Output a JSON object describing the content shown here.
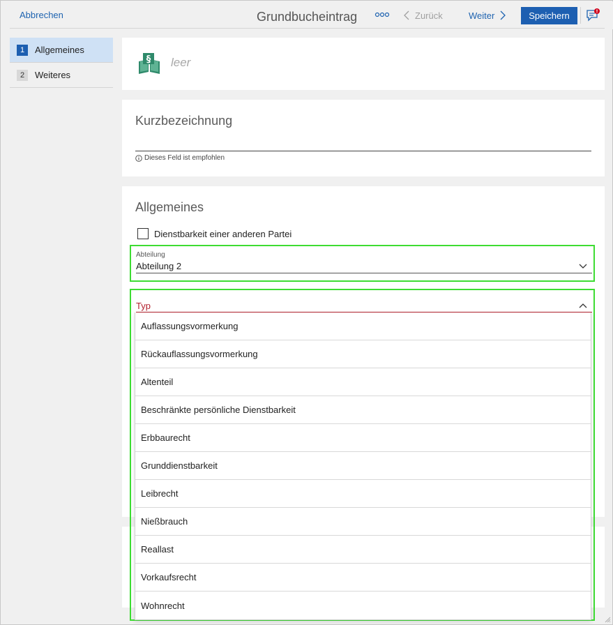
{
  "header": {
    "cancel_label": "Abbrechen",
    "title": "Grundbucheintrag",
    "more_icon": "more-horizontal-icon",
    "back_label": "Zurück",
    "forward_label": "Weiter",
    "save_label": "Speichern",
    "chat_icon": "chat-notification-icon"
  },
  "sidebar": {
    "items": [
      {
        "num": "1",
        "label": "Allgemeines",
        "active": true
      },
      {
        "num": "2",
        "label": "Weiteres",
        "active": false
      }
    ]
  },
  "header_card": {
    "icon": "law-book-icon",
    "empty_text": "leer"
  },
  "kurz": {
    "label": "Kurzbezeichnung",
    "value": "",
    "hint": "Dieses Feld ist empfohlen"
  },
  "allgemeines": {
    "title": "Allgemeines",
    "checkbox_label": "Dienstbarkeit einer anderen Partei",
    "checkbox_checked": false,
    "abteilung_label": "Abteilung",
    "abteilung_value": "Abteilung 2",
    "typ_label": "Typ",
    "typ_options": [
      "Auflassungsvormerkung",
      "Rückauflassungsvormerkung",
      "Altenteil",
      "Beschränkte persönliche Dienstbarkeit",
      "Erbbaurecht",
      "Grunddienstbarkeit",
      "Leibrecht",
      "Nießbrauch",
      "Reallast",
      "Vorkaufsrecht",
      "Wohnrecht"
    ]
  },
  "colors": {
    "accent": "#1d5fb1",
    "highlight": "#3ddc32",
    "error": "#b3202d",
    "book_green": "#2f8a6b"
  }
}
